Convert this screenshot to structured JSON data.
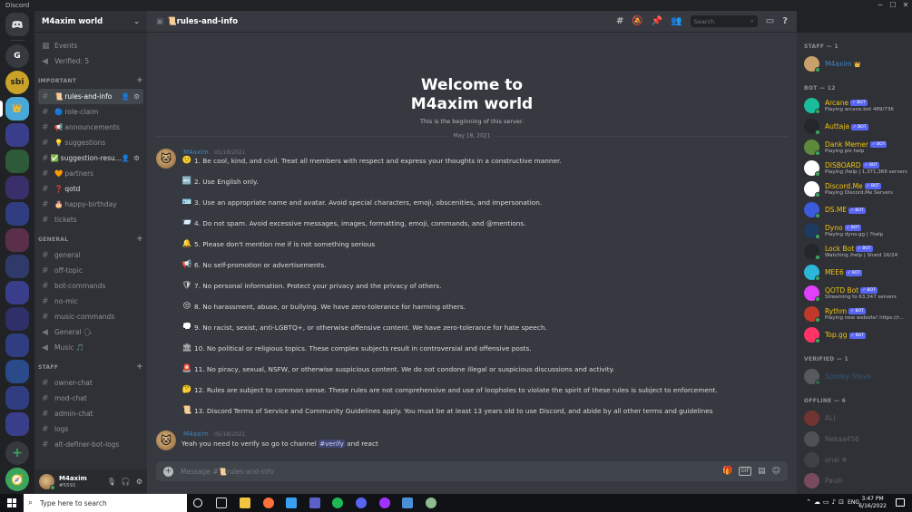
{
  "window": {
    "title": "Discord"
  },
  "server": {
    "name": "M4axim world",
    "top_items": [
      {
        "icon": "calendar-icon",
        "label": "Events"
      },
      {
        "icon": "speaker-icon",
        "label": "Verified: 5"
      }
    ],
    "categories": [
      {
        "name": "IMPORTANT",
        "channels": [
          {
            "emoji": "📜",
            "name": "rules-and-info",
            "active": true
          },
          {
            "emoji": "🔵",
            "name": "role-claim"
          },
          {
            "emoji": "📢",
            "name": "announcements"
          },
          {
            "emoji": "💡",
            "name": "suggestions"
          },
          {
            "emoji": "✅",
            "name": "suggestion-resu...",
            "bright": true
          },
          {
            "emoji": "🧡",
            "name": "partners"
          },
          {
            "emoji": "❓",
            "name": "qotd",
            "bright": true
          },
          {
            "emoji": "🎂",
            "name": "happy-birthday"
          },
          {
            "emoji": "",
            "name": "tickets"
          }
        ]
      },
      {
        "name": "GENERAL",
        "channels": [
          {
            "emoji": "",
            "name": "general"
          },
          {
            "emoji": "",
            "name": "off-topic"
          },
          {
            "emoji": "",
            "name": "bot-commands"
          },
          {
            "emoji": "",
            "name": "no-mic"
          },
          {
            "emoji": "",
            "name": "music-commands"
          },
          {
            "emoji": "",
            "name": "General 🗣",
            "voice": true
          },
          {
            "emoji": "",
            "name": "Music 🎵",
            "voice": true
          }
        ]
      },
      {
        "name": "STAFF",
        "channels": [
          {
            "emoji": "",
            "name": "owner-chat"
          },
          {
            "emoji": "",
            "name": "mod-chat"
          },
          {
            "emoji": "",
            "name": "admin-chat"
          },
          {
            "emoji": "",
            "name": "logs"
          },
          {
            "emoji": "",
            "name": "alt-definer-bot-logs"
          }
        ]
      }
    ]
  },
  "user": {
    "name": "M4axim",
    "tag": "#5591"
  },
  "channel": {
    "emoji": "📜",
    "name": "rules-and-info"
  },
  "search": {
    "placeholder": "Search"
  },
  "welcome": {
    "title_line1": "Welcome to",
    "title_line2": "M4axim world",
    "subtitle": "This is the beginning of this server."
  },
  "date_divider": "May 18, 2021",
  "messages": [
    {
      "author": "M4axim",
      "timestamp": "05/18/2021"
    },
    {
      "author": "M4axim",
      "timestamp": "05/18/2021",
      "text_before": "Yeah you need to verify so go to channel",
      "mention": "#verify",
      "text_after": "and react"
    }
  ],
  "rules": [
    {
      "emoji": "🙂",
      "text": "1. Be cool, kind, and civil. Treat all members with respect and express your thoughts in a constructive manner."
    },
    {
      "emoji": "🔤",
      "text": "2. Use English only."
    },
    {
      "emoji": "🪪",
      "text": "3. Use an appropriate name and avatar. Avoid special characters, emoji, obscenities, and impersonation."
    },
    {
      "emoji": "📨",
      "text": "4. Do not spam. Avoid excessive messages, images, formatting, emoji, commands, and @mentions."
    },
    {
      "emoji": "🔔",
      "text": "5. Please don't mention me if is not something serious"
    },
    {
      "emoji": "📢",
      "text": "6. No self-promotion or advertisements."
    },
    {
      "emoji": "🛡",
      "text": "7. No personal information. Protect your privacy and the privacy of others."
    },
    {
      "emoji": "😒",
      "text": "8. No harassment, abuse, or bullying. We have zero-tolerance for harming others."
    },
    {
      "emoji": "💭",
      "text": "9. No racist, sexist, anti-LGBTQ+, or otherwise offensive content. We have zero-tolerance for hate speech."
    },
    {
      "emoji": "🏛",
      "text": "10. No political or religious topics. These complex subjects result in controversial and offensive posts."
    },
    {
      "emoji": "🚨",
      "text": "11. No piracy, sexual, NSFW, or otherwise suspicious content. We do not condone illegal or suspicious discussions and activity."
    },
    {
      "emoji": "🤔",
      "text": "12. Rules are subject to common sense. These rules are not comprehensive and use of loopholes to violate the spirit of these rules is subject to enforcement."
    },
    {
      "emoji": "📜",
      "text": "13. Discord Terms of Service and Community Guidelines apply. You must be at least 13 years old to use Discord, and abide by all other terms and guidelines"
    }
  ],
  "composer": {
    "placeholder": "Message #📜rules-and-info"
  },
  "member_groups": [
    {
      "title": "STAFF — 1",
      "members": [
        {
          "name": "M4axim",
          "crown": "👑",
          "color": "#3d84c6",
          "avatar": "#c8a06a"
        }
      ]
    },
    {
      "title": "BOT — 12",
      "members": [
        {
          "name": "Arcane",
          "bot": "✓ BOT",
          "activity": "Playing arcane.bot 489/736",
          "color": "#f1c40f",
          "avatar": "#1abc9c"
        },
        {
          "name": "Auttaja",
          "bot": "✓ BOT",
          "activity": "",
          "color": "#f1c40f",
          "avatar": "#23272a"
        },
        {
          "name": "Dank Memer",
          "bot": "✓ BOT",
          "activity": "Playing pls help",
          "color": "#f1c40f",
          "avatar": "#5d8a3a"
        },
        {
          "name": "DISBOARD",
          "bot": "✓ BOT",
          "activity": "Playing /help | 1,371,369 servers",
          "color": "#f1c40f",
          "avatar": "#ffffff"
        },
        {
          "name": "Discord.Me",
          "bot": "✓ BOT",
          "activity": "Playing Discord.Me Servers",
          "color": "#f1c40f",
          "avatar": "#ffffff"
        },
        {
          "name": "DS.ME",
          "bot": "✓ BOT",
          "activity": "",
          "color": "#f1c40f",
          "avatar": "#3b5bdb"
        },
        {
          "name": "Dyno",
          "bot": "✓ BOT",
          "activity": "Playing dyno.gg | ?help",
          "color": "#f1c40f",
          "avatar": "#1e3a5f"
        },
        {
          "name": "Lock Bot",
          "bot": "✓ BOT",
          "activity": "Watching /help | Shard 16/24",
          "color": "#f1c40f",
          "avatar": "#23272a"
        },
        {
          "name": "MEE6",
          "bot": "✓ BOT",
          "activity": "",
          "color": "#f1c40f",
          "avatar": "#2bb7d8"
        },
        {
          "name": "QOTD Bot",
          "bot": "✓ BOT",
          "activity": "Streaming to 63,347 servers",
          "color": "#f1c40f",
          "avatar": "#e040fb"
        },
        {
          "name": "Rythm",
          "bot": "✓ BOT",
          "activity": "Playing new website! https://r...",
          "color": "#f1c40f",
          "avatar": "#c0392b"
        },
        {
          "name": "Top.gg",
          "bot": "✓ BOT",
          "activity": "",
          "color": "#f1c40f",
          "avatar": "#ff3366"
        }
      ]
    },
    {
      "title": "VERIFIED — 1",
      "members": [
        {
          "name": "Spooky Steve",
          "color": "#3d84c6",
          "avatar": "#8a8a8a",
          "dim": true
        }
      ]
    },
    {
      "title": "OFFLINE — 6",
      "members": [
        {
          "name": "ALI",
          "color": "#96989d",
          "avatar": "#c0392b",
          "dim": true
        },
        {
          "name": "Nekaa456",
          "color": "#96989d",
          "avatar": "#777777",
          "dim": true
        },
        {
          "name": "onai ❄",
          "color": "#96989d",
          "avatar": "#555555",
          "dim": true
        },
        {
          "name": "Paulii",
          "color": "#96989d",
          "avatar": "#d46a8a",
          "dim": true
        }
      ]
    }
  ],
  "taskbar": {
    "search_placeholder": "Type here to search",
    "time": "3:47 PM",
    "date": "6/16/2022",
    "lang": "ENG"
  }
}
